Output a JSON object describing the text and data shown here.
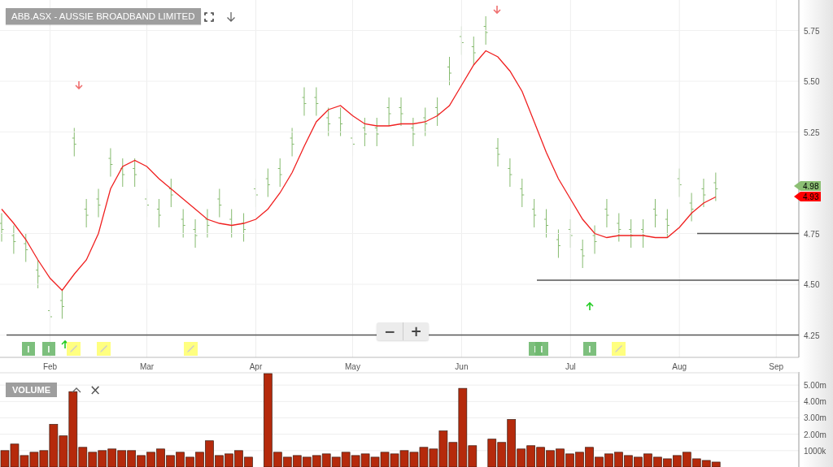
{
  "title": "ABB.ASX - AUSSIE BROADBAND LIMITED",
  "price_chart": {
    "zoom_out": "−",
    "zoom_in": "+",
    "chart_data": {
      "type": "line",
      "grid": true,
      "ylim": [
        4.14,
        5.9
      ],
      "categories": [
        null,
        null,
        null,
        null,
        "Feb",
        null,
        null,
        null,
        null,
        null,
        null,
        null,
        "Mar",
        null,
        null,
        null,
        null,
        null,
        null,
        null,
        null,
        "Apr",
        null,
        null,
        null,
        null,
        null,
        null,
        null,
        "May",
        null,
        null,
        null,
        null,
        null,
        null,
        null,
        null,
        "Jun",
        null,
        null,
        null,
        null,
        null,
        null,
        null,
        null,
        "Jul",
        null,
        null,
        null,
        null,
        null,
        null,
        null,
        null,
        "Aug",
        null,
        null,
        null,
        null,
        null,
        null,
        null,
        "Sep",
        null
      ],
      "yticks": [
        {
          "value": 4.25,
          "label": "4.25"
        },
        {
          "value": 4.5,
          "label": "4.50"
        },
        {
          "value": 4.75,
          "label": "4.75"
        },
        {
          "value": 5.25,
          "label": "5.25"
        },
        {
          "value": 5.5,
          "label": "5.50"
        },
        {
          "value": 5.75,
          "label": "5.75"
        }
      ],
      "series": [
        {
          "color": "#f02020",
          "values": [
            4.87,
            4.8,
            4.72,
            4.62,
            4.53,
            4.47,
            4.55,
            4.62,
            4.75,
            4.97,
            5.08,
            5.11,
            5.08,
            5.02,
            4.97,
            4.92,
            4.87,
            4.82,
            4.8,
            4.79,
            4.8,
            4.82,
            4.87,
            4.95,
            5.05,
            5.18,
            5.3,
            5.36,
            5.38,
            5.33,
            5.29,
            5.28,
            5.28,
            5.29,
            5.29,
            5.3,
            5.33,
            5.38,
            5.48,
            5.58,
            5.65,
            5.62,
            5.55,
            5.45,
            5.3,
            5.15,
            5.02,
            4.92,
            4.82,
            4.75,
            4.73,
            4.74,
            4.74,
            4.74,
            4.73,
            4.73,
            4.78,
            4.85,
            4.9,
            4.93,
            null,
            null,
            null,
            null,
            null,
            null
          ]
        }
      ],
      "ref_lines": [
        {
          "axis": "y",
          "value": 4.75
        },
        {
          "axis": "y",
          "value": 4.52
        },
        {
          "axis": "y",
          "value": 4.25
        }
      ]
    },
    "price_tags": [
      {
        "text": "4.98",
        "color": "#8cbf74"
      },
      {
        "text": "4.93",
        "color": "#ff0000"
      }
    ],
    "markers": [
      {
        "kind": "info",
        "label": "I"
      },
      {
        "kind": "info",
        "label": "I"
      },
      {
        "kind": "up"
      },
      {
        "kind": "note"
      },
      {
        "kind": "down"
      },
      {
        "kind": "note"
      },
      {
        "kind": "note"
      },
      {
        "kind": "down"
      },
      {
        "kind": "info",
        "label": "I"
      },
      {
        "kind": "info",
        "label": "I"
      },
      {
        "kind": "info",
        "label": "I"
      },
      {
        "kind": "up"
      },
      {
        "kind": "note"
      }
    ]
  },
  "volume_chart": {
    "label": "VOLUME",
    "close": "×",
    "chart_data": {
      "type": "bar",
      "grid": true,
      "ylim": [
        0,
        5750000
      ],
      "yticks": [
        {
          "value": 1000000,
          "label": "1000k"
        },
        {
          "value": 2000000,
          "label": "2.00m"
        },
        {
          "value": 3000000,
          "label": "3.00m"
        },
        {
          "value": 4000000,
          "label": "4.00m"
        },
        {
          "value": 5000000,
          "label": "5.00m"
        }
      ],
      "values": [
        1000000,
        1400000,
        700000,
        900000,
        1000000,
        2600000,
        1900000,
        4600000,
        1200000,
        900000,
        1000000,
        1100000,
        1000000,
        1000000,
        700000,
        900000,
        1100000,
        700000,
        900000,
        600000,
        900000,
        1600000,
        700000,
        800000,
        1000000,
        600000,
        null,
        5700000,
        900000,
        600000,
        700000,
        600000,
        700000,
        800000,
        600000,
        900000,
        700000,
        800000,
        600000,
        900000,
        800000,
        1000000,
        900000,
        1200000,
        1100000,
        2200000,
        1500000,
        4800000,
        1300000,
        null,
        1700000,
        1500000,
        2900000,
        1100000,
        1300000,
        1200000,
        1000000,
        1100000,
        800000,
        900000,
        1200000,
        600000,
        800000,
        900000,
        700000,
        600000,
        800000,
        600000,
        500000,
        700000,
        900000,
        500000,
        400000,
        300000,
        null,
        null,
        null,
        null,
        null,
        null,
        null,
        null
      ]
    }
  }
}
